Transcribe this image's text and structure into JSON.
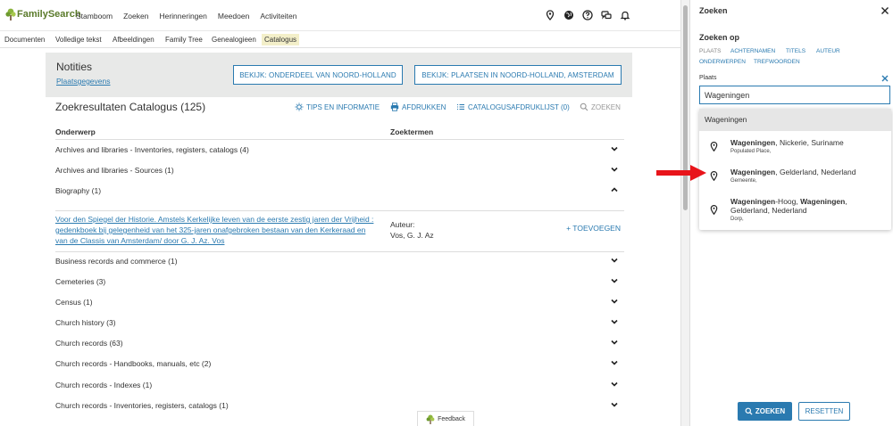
{
  "app": {
    "logo_text": "FamilySearch"
  },
  "nav": {
    "items": [
      "Stamboom",
      "Zoeken",
      "Herinneringen",
      "Meedoen",
      "Activiteiten"
    ]
  },
  "subnav": {
    "items": [
      "Documenten",
      "Volledige tekst",
      "Afbeeldingen",
      "Family Tree",
      "Genealogieen",
      "Catalogus"
    ],
    "active": "Catalogus"
  },
  "notes": {
    "title": "Notities",
    "link": "Plaatsgegevens",
    "btn_subdivision": "BEKIJK: ONDERDEEL VAN NOORD-HOLLAND",
    "btn_places": "BEKIJK: PLAATSEN IN NOORD-HOLLAND, AMSTERDAM"
  },
  "results": {
    "title": "Zoekresultaten Catalogus (125)",
    "toolbar": {
      "tips": "TIPS EN INFORMATIE",
      "print": "AFDRUKKEN",
      "catalog_print_list": "CATALOGUSAFDRUKLIJST (0)",
      "search": "ZOEKEN"
    },
    "col_subject": "Onderwerp",
    "col_terms": "Zoektermen",
    "rows_top": [
      "Archives and libraries - Inventories, registers, catalogs (4)",
      "Archives and libraries - Sources (1)",
      "Biography (1)"
    ],
    "record": {
      "title": "Voor den Spiegel der Historie. Amstels Kerkelijke leven van de eerste zestig jaren der Vrijheid : gedenkboek bij gelegenheid van het 325-jaren onafgebroken bestaan van den Kerkeraad en van de Classis van Amsterdam/ door G. J. Az. Vos",
      "author_label": "Auteur:",
      "author_value": "Vos, G. J. Az",
      "add_label": "+  TOEVOEGEN"
    },
    "rows_bottom": [
      "Business records and commerce (1)",
      "Cemeteries (3)",
      "Census (1)",
      "Church history (3)",
      "Church records (63)",
      "Church records - Handbooks, manuals, etc (2)",
      "Church records - Indexes (1)",
      "Church records - Inventories, registers, catalogs (1)"
    ]
  },
  "feedback": {
    "label": "Feedback"
  },
  "panel": {
    "title": "Zoeken",
    "search_on": "Zoeken op",
    "tabs": [
      "PLAATS",
      "ACHTERNAMEN",
      "TITELS",
      "AUTEUR",
      "ONDERWERPEN",
      "TREFWOORDEN"
    ],
    "active_tab": "PLAATS",
    "place_label": "Plaats",
    "place_value": "Wageningen",
    "dropdown": {
      "header": "Wageningen",
      "options": [
        {
          "bold": "Wageningen",
          "rest": ", Nickerie, Suriname",
          "sub": "Populated Place,"
        },
        {
          "bold": "Wageningen",
          "rest": ", Gelderland, Nederland",
          "sub": "Gemeente,"
        },
        {
          "bold1": "Wageningen",
          "mid": "-Hoog, ",
          "bold2": "Wageningen",
          "rest": ", Gelderland, Nederland",
          "sub": "Dorp,"
        }
      ]
    },
    "btn_search": "ZOEKEN",
    "btn_reset": "RESETTEN"
  },
  "colors": {
    "accent": "#2a7ab0",
    "arrow": "#e8141a",
    "logo": "#5a7a2a",
    "active_tab_bg": "#f3efc9",
    "notes_bg": "#e8e9e8"
  },
  "icons": [
    "location-pin-icon",
    "globe-icon",
    "help-icon",
    "chat-icon",
    "bell-icon",
    "close-icon",
    "chevron-down-icon",
    "chevron-up-icon",
    "search-icon",
    "print-icon",
    "list-icon",
    "lightbulb-icon"
  ]
}
